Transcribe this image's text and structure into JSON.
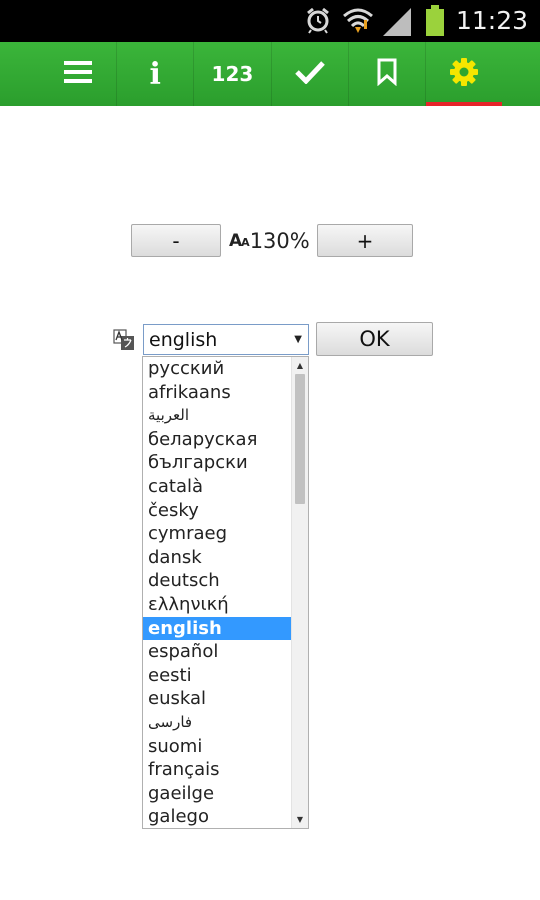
{
  "status_bar": {
    "time": "11:23",
    "icons": [
      "alarm-icon",
      "wifi-icon",
      "signal-icon",
      "battery-icon"
    ]
  },
  "toolbar": {
    "items": [
      {
        "icon": "menu-icon"
      },
      {
        "icon": "info-icon",
        "label": "i"
      },
      {
        "icon": "numbers-icon",
        "label": "123"
      },
      {
        "icon": "check-icon"
      },
      {
        "icon": "bookmark-icon"
      },
      {
        "icon": "gear-icon",
        "active": true
      }
    ],
    "accent": "#2ea62f",
    "active_indicator": "#e6242a"
  },
  "zoom": {
    "minus_label": "-",
    "aa_label": "A",
    "aa_small": "A",
    "value": "130%",
    "plus_label": "+"
  },
  "language": {
    "selected": "english",
    "ok_label": "OK",
    "options": [
      "русский",
      "afrikaans",
      "العربية",
      "беларуская",
      "български",
      "català",
      "česky",
      "cymraeg",
      "dansk",
      "deutsch",
      "ελληνική",
      "english",
      "español",
      "eesti",
      "euskal",
      "فارسی",
      "suomi",
      "français",
      "gaeilge",
      "galego"
    ],
    "highlight_color": "#3399ff"
  }
}
